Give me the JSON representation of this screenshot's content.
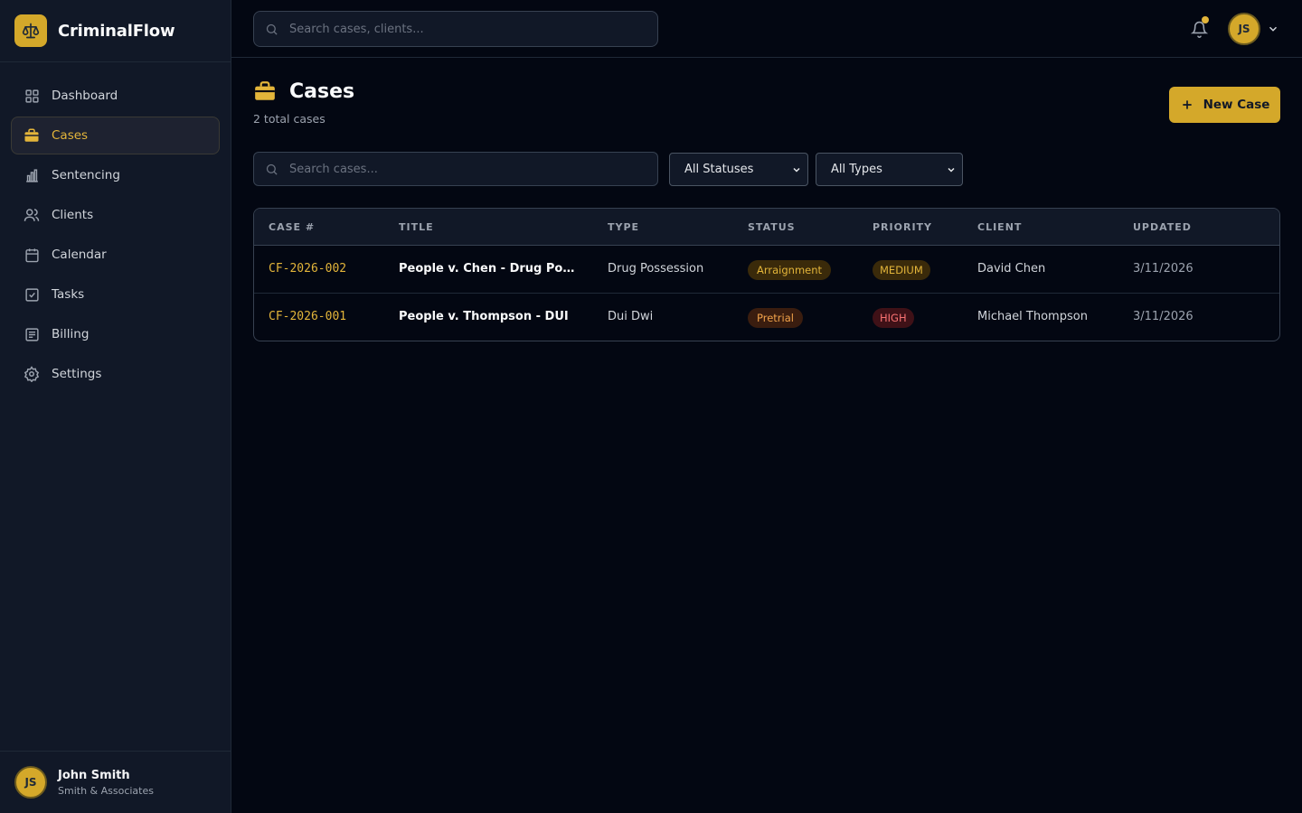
{
  "app": {
    "name": "CriminalFlow"
  },
  "sidebar": {
    "items": [
      {
        "label": "Dashboard",
        "icon": "grid-icon"
      },
      {
        "label": "Cases",
        "icon": "briefcase-icon",
        "active": true
      },
      {
        "label": "Sentencing",
        "icon": "bar-chart-icon"
      },
      {
        "label": "Clients",
        "icon": "users-icon"
      },
      {
        "label": "Calendar",
        "icon": "calendar-icon"
      },
      {
        "label": "Tasks",
        "icon": "checkbox-icon"
      },
      {
        "label": "Billing",
        "icon": "receipt-icon"
      },
      {
        "label": "Settings",
        "icon": "gear-icon"
      }
    ],
    "user": {
      "initials": "JS",
      "name": "John Smith",
      "firm": "Smith & Associates"
    }
  },
  "topbar": {
    "search_placeholder": "Search cases, clients...",
    "avatar_initials": "JS"
  },
  "page": {
    "title": "Cases",
    "subtitle": "2 total cases",
    "new_button": "New Case"
  },
  "filters": {
    "search_placeholder": "Search cases...",
    "status_selected": "All Statuses",
    "type_selected": "All Types"
  },
  "table": {
    "columns": [
      "CASE #",
      "TITLE",
      "TYPE",
      "STATUS",
      "PRIORITY",
      "CLIENT",
      "UPDATED"
    ],
    "rows": [
      {
        "case_no": "CF-2026-002",
        "title": "People v. Chen - Drug Posses...",
        "type": "Drug Possession",
        "status": "Arraignment",
        "priority": "MEDIUM",
        "client": "David Chen",
        "updated": "3/11/2026"
      },
      {
        "case_no": "CF-2026-001",
        "title": "People v. Thompson - DUI",
        "type": "Dui Dwi",
        "status": "Pretrial",
        "priority": "HIGH",
        "client": "Michael Thompson",
        "updated": "3/11/2026"
      }
    ]
  },
  "colors": {
    "accent": "#d4a82a",
    "background": "#030712",
    "sidebar": "#111827"
  }
}
